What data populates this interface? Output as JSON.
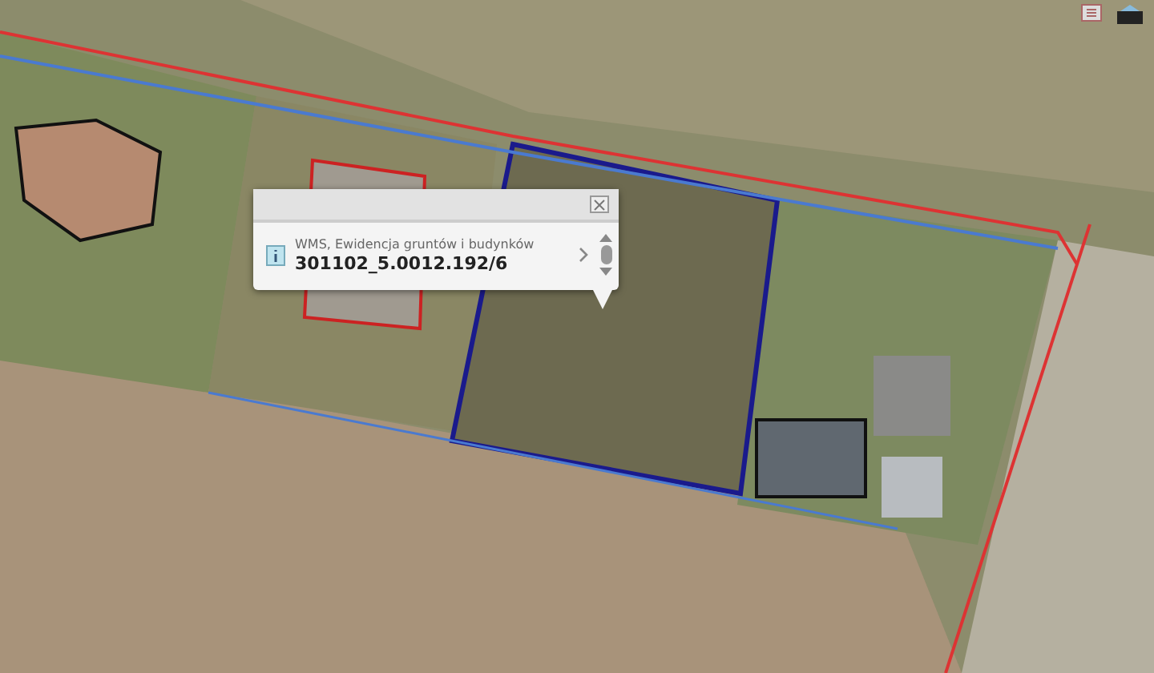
{
  "popup": {
    "layer": "WMS, Ewidencja gruntów i budynków",
    "parcel_id": "301102_5.0012.192/6"
  }
}
